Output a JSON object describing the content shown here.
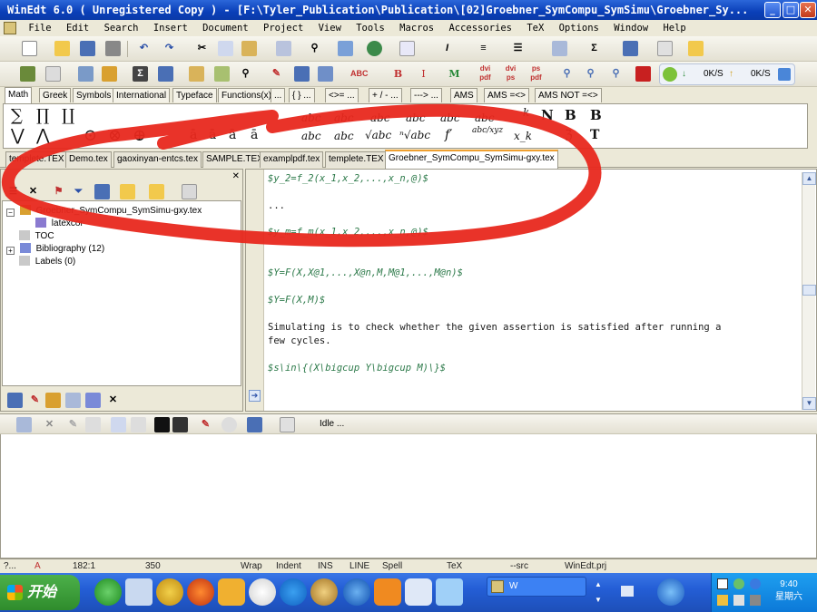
{
  "window": {
    "title": "WinEdt 6.0  ( Unregistered  Copy )  - [F:\\Tyler_Publication\\Publication\\[02]Groebner_SymCompu_SymSimu\\Groebner_Sy...",
    "minimize_icon": "_",
    "maximize_icon": "□",
    "close_icon": "✕"
  },
  "menu": [
    "File",
    "Edit",
    "Search",
    "Insert",
    "Document",
    "Project",
    "View",
    "Tools",
    "Macros",
    "Accessories",
    "TeX",
    "Options",
    "Window",
    "Help"
  ],
  "toolbar2": {
    "speed_down": "0K/S",
    "speed_up": "0K/S",
    "bold": "B",
    "italic": "I",
    "math": "M",
    "dvi_pdf": "dvi\npdf",
    "dvi_ps": "dvi\nps",
    "ps_pdf": "ps\npdf"
  },
  "math_tabs": [
    "Math",
    "Greek",
    "Symbols",
    "International",
    "Typeface",
    "Functions(x)",
    "...",
    "{ } ...",
    "<>= ...",
    "+ / - ...",
    "---> ...",
    "AMS",
    "AMS =<>",
    "AMS NOT =<>"
  ],
  "math_symbols": {
    "row1": [
      "∑",
      "∏",
      "∐",
      "abc",
      "abc",
      "abc",
      "abc",
      "abc",
      "abc",
      "k",
      "N",
      "B",
      "B"
    ],
    "row2": [
      "⋁",
      "⋀",
      "⊙",
      "⊗",
      "⊕",
      "ā",
      "ā",
      "ā",
      "ā",
      "abc",
      "abc",
      "√abc",
      "ⁿ√abc",
      "f′",
      "abc/xyz",
      "x_k",
      "ℨ",
      "T"
    ]
  },
  "doc_tabs": [
    "templete.TEX",
    "Demo.tex",
    "gaoxinyan-entcs.tex",
    "SAMPLE.TEX",
    "examplpdf.tex",
    "templete.TEX",
    "Groebner_SymCompu_SymSimu-gxy.tex"
  ],
  "tree": {
    "root": "Groebner_SymCompu_SymSimu-gxy.tex",
    "child": "latexcor",
    "toc": "TOC",
    "bibliography": "Bibliography  (12)",
    "labels": "Labels  (0)"
  },
  "editor_lines": [
    {
      "text": "$y_2=f_2(x_1,x_2,...,x_n,@)$",
      "kind": "math"
    },
    {
      "text": "...",
      "kind": "text"
    },
    {
      "text": "$y_m=f_m(x_1,x_2,...,x_n,@)$",
      "kind": "math"
    },
    {
      "text": "$Y=F(X,X@1,...,X@n,M,M@1,...,M@n)$",
      "kind": "math"
    },
    {
      "text": "$Y=F(X,M)$",
      "kind": "math"
    },
    {
      "text": "Simulating is to check whether the given assertion is satisfied after running a",
      "kind": "text"
    },
    {
      "text": "few cycles.",
      "kind": "text"
    },
    {
      "text": "$s\\in\\{(X\\bigcup Y\\bigcup M)\\}$",
      "kind": "math"
    }
  ],
  "output_toolbar": {
    "status": "Idle ..."
  },
  "statusbar": {
    "help": "?...",
    "mode": "A",
    "position": "182:1",
    "lines": "350",
    "wrap": "Wrap",
    "indent": "Indent",
    "ins": "INS",
    "line": "LINE",
    "spell": "Spell",
    "tex": "TeX",
    "src": "--src",
    "project": "WinEdt.prj"
  },
  "taskbar": {
    "start_label": "开始",
    "task_item": "W",
    "clock_time": "9:40",
    "clock_day": "星期六"
  },
  "colors": {
    "titlebar": "#0a3fb8",
    "math_text": "#2d7a4a",
    "annotation": "#e8281e",
    "active_tab_accent": "#f0a030"
  }
}
